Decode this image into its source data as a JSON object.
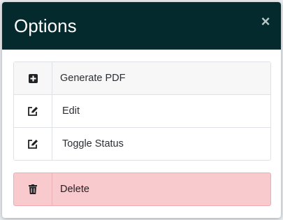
{
  "modal": {
    "title": "Options",
    "close_symbol": "×"
  },
  "options": [
    {
      "label": "Generate PDF",
      "icon": "plus-square-icon"
    },
    {
      "label": "Edit",
      "icon": "edit-icon"
    },
    {
      "label": "Toggle Status",
      "icon": "edit-icon"
    }
  ],
  "delete": {
    "label": "Delete",
    "icon": "trash-icon"
  },
  "colors": {
    "header_bg": "#052a2e",
    "danger_bg": "#f8c9cd"
  }
}
